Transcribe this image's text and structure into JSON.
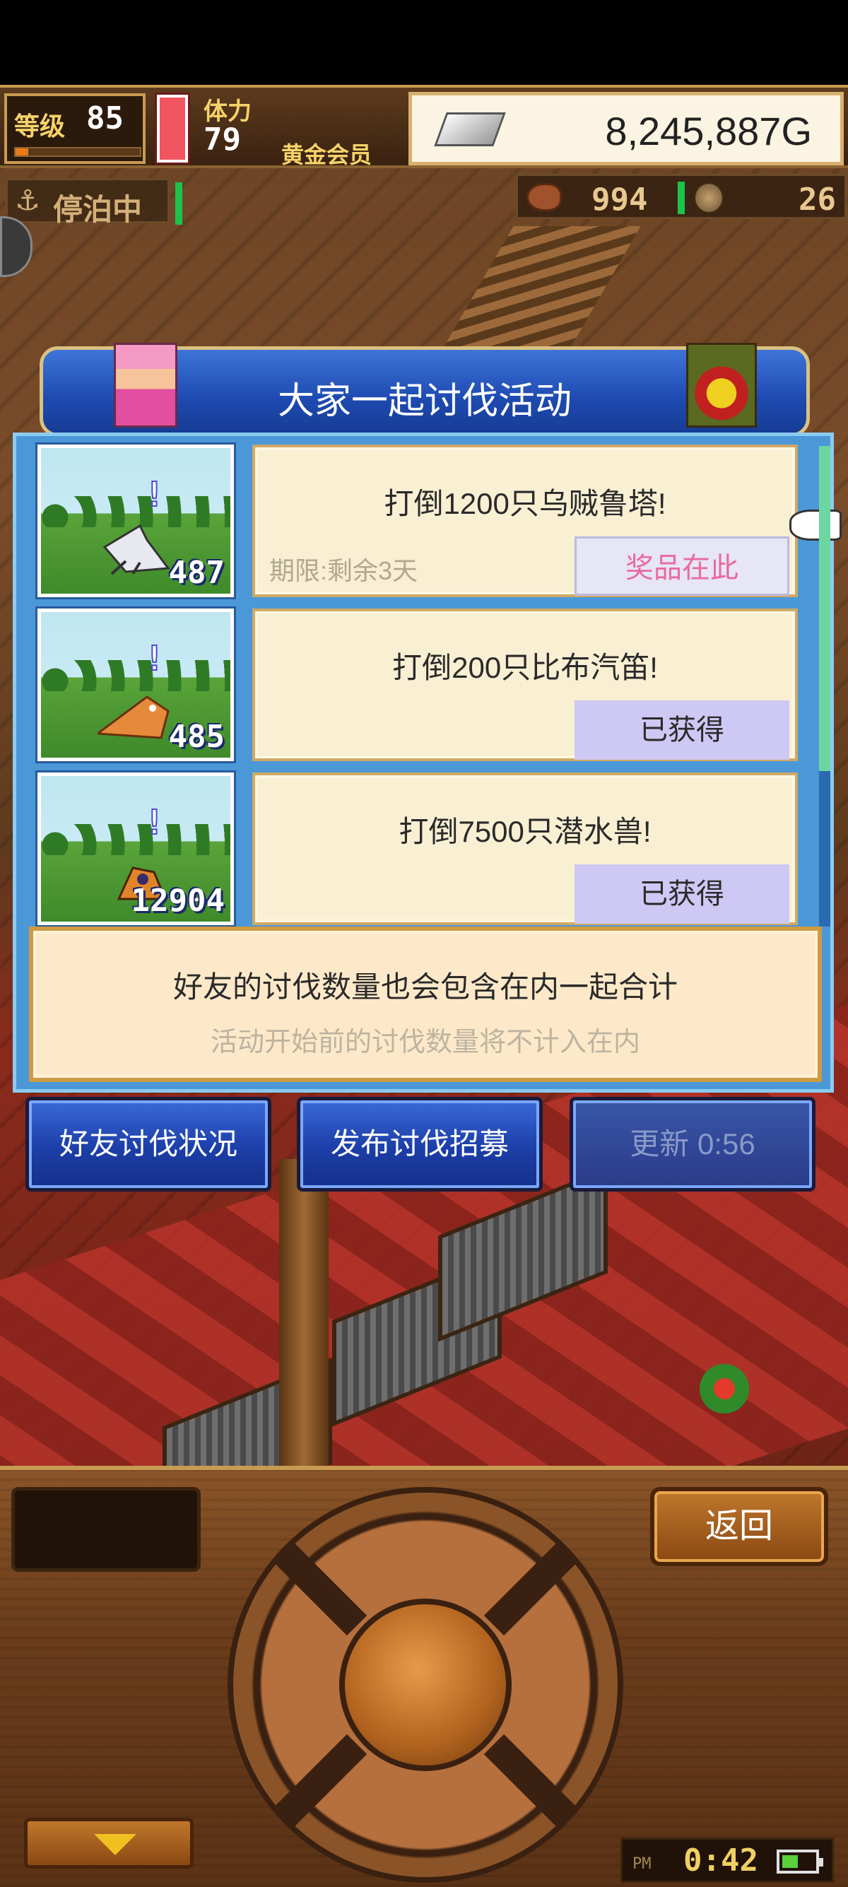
{
  "status_bar": {
    "level_label": "等级",
    "level_value": "85",
    "level_progress": 0.1,
    "stamina_label": "体力",
    "stamina_value": "79",
    "membership": "黄金会员",
    "gold": "8,245,887G",
    "gold_icon": "silver-bar-icon"
  },
  "sub_status": {
    "docked_label": "停泊中",
    "anchor_icon": "anchor-icon",
    "food_count": "994",
    "medal_count": "26"
  },
  "modal": {
    "title": "大家一起讨伐活动",
    "quests": [
      {
        "thumb_count": "487",
        "thumb_exclaim": "!",
        "text": "打倒1200只乌贼鲁塔!",
        "deadline": "期限:剩余3天",
        "button": "奖品在此",
        "button_state": "prize"
      },
      {
        "thumb_count": "485",
        "thumb_exclaim": "!",
        "text": "打倒200只比布汽笛!",
        "deadline": "",
        "button": "已获得",
        "button_state": "claimed"
      },
      {
        "thumb_count": "12904",
        "thumb_exclaim": "!",
        "text": "打倒7500只潜水兽!",
        "deadline": "",
        "button": "已获得",
        "button_state": "claimed"
      }
    ],
    "note_main": "好友的讨伐数量也会包含在内一起合计",
    "note_sub": "活动开始前的讨伐数量将不计入在内"
  },
  "actions": {
    "friend_status": "好友讨伐状况",
    "post_recruit": "发布讨伐招募",
    "refresh": "更新 0:56"
  },
  "console": {
    "back": "返回",
    "clock_ampm": "PM",
    "clock_time": "0:42"
  },
  "colors": {
    "modal_blue": "#1e4ab0",
    "card_bg": "#f9efd3",
    "prize_text": "#e96aa0",
    "claimed_bg": "#cec8f4"
  }
}
